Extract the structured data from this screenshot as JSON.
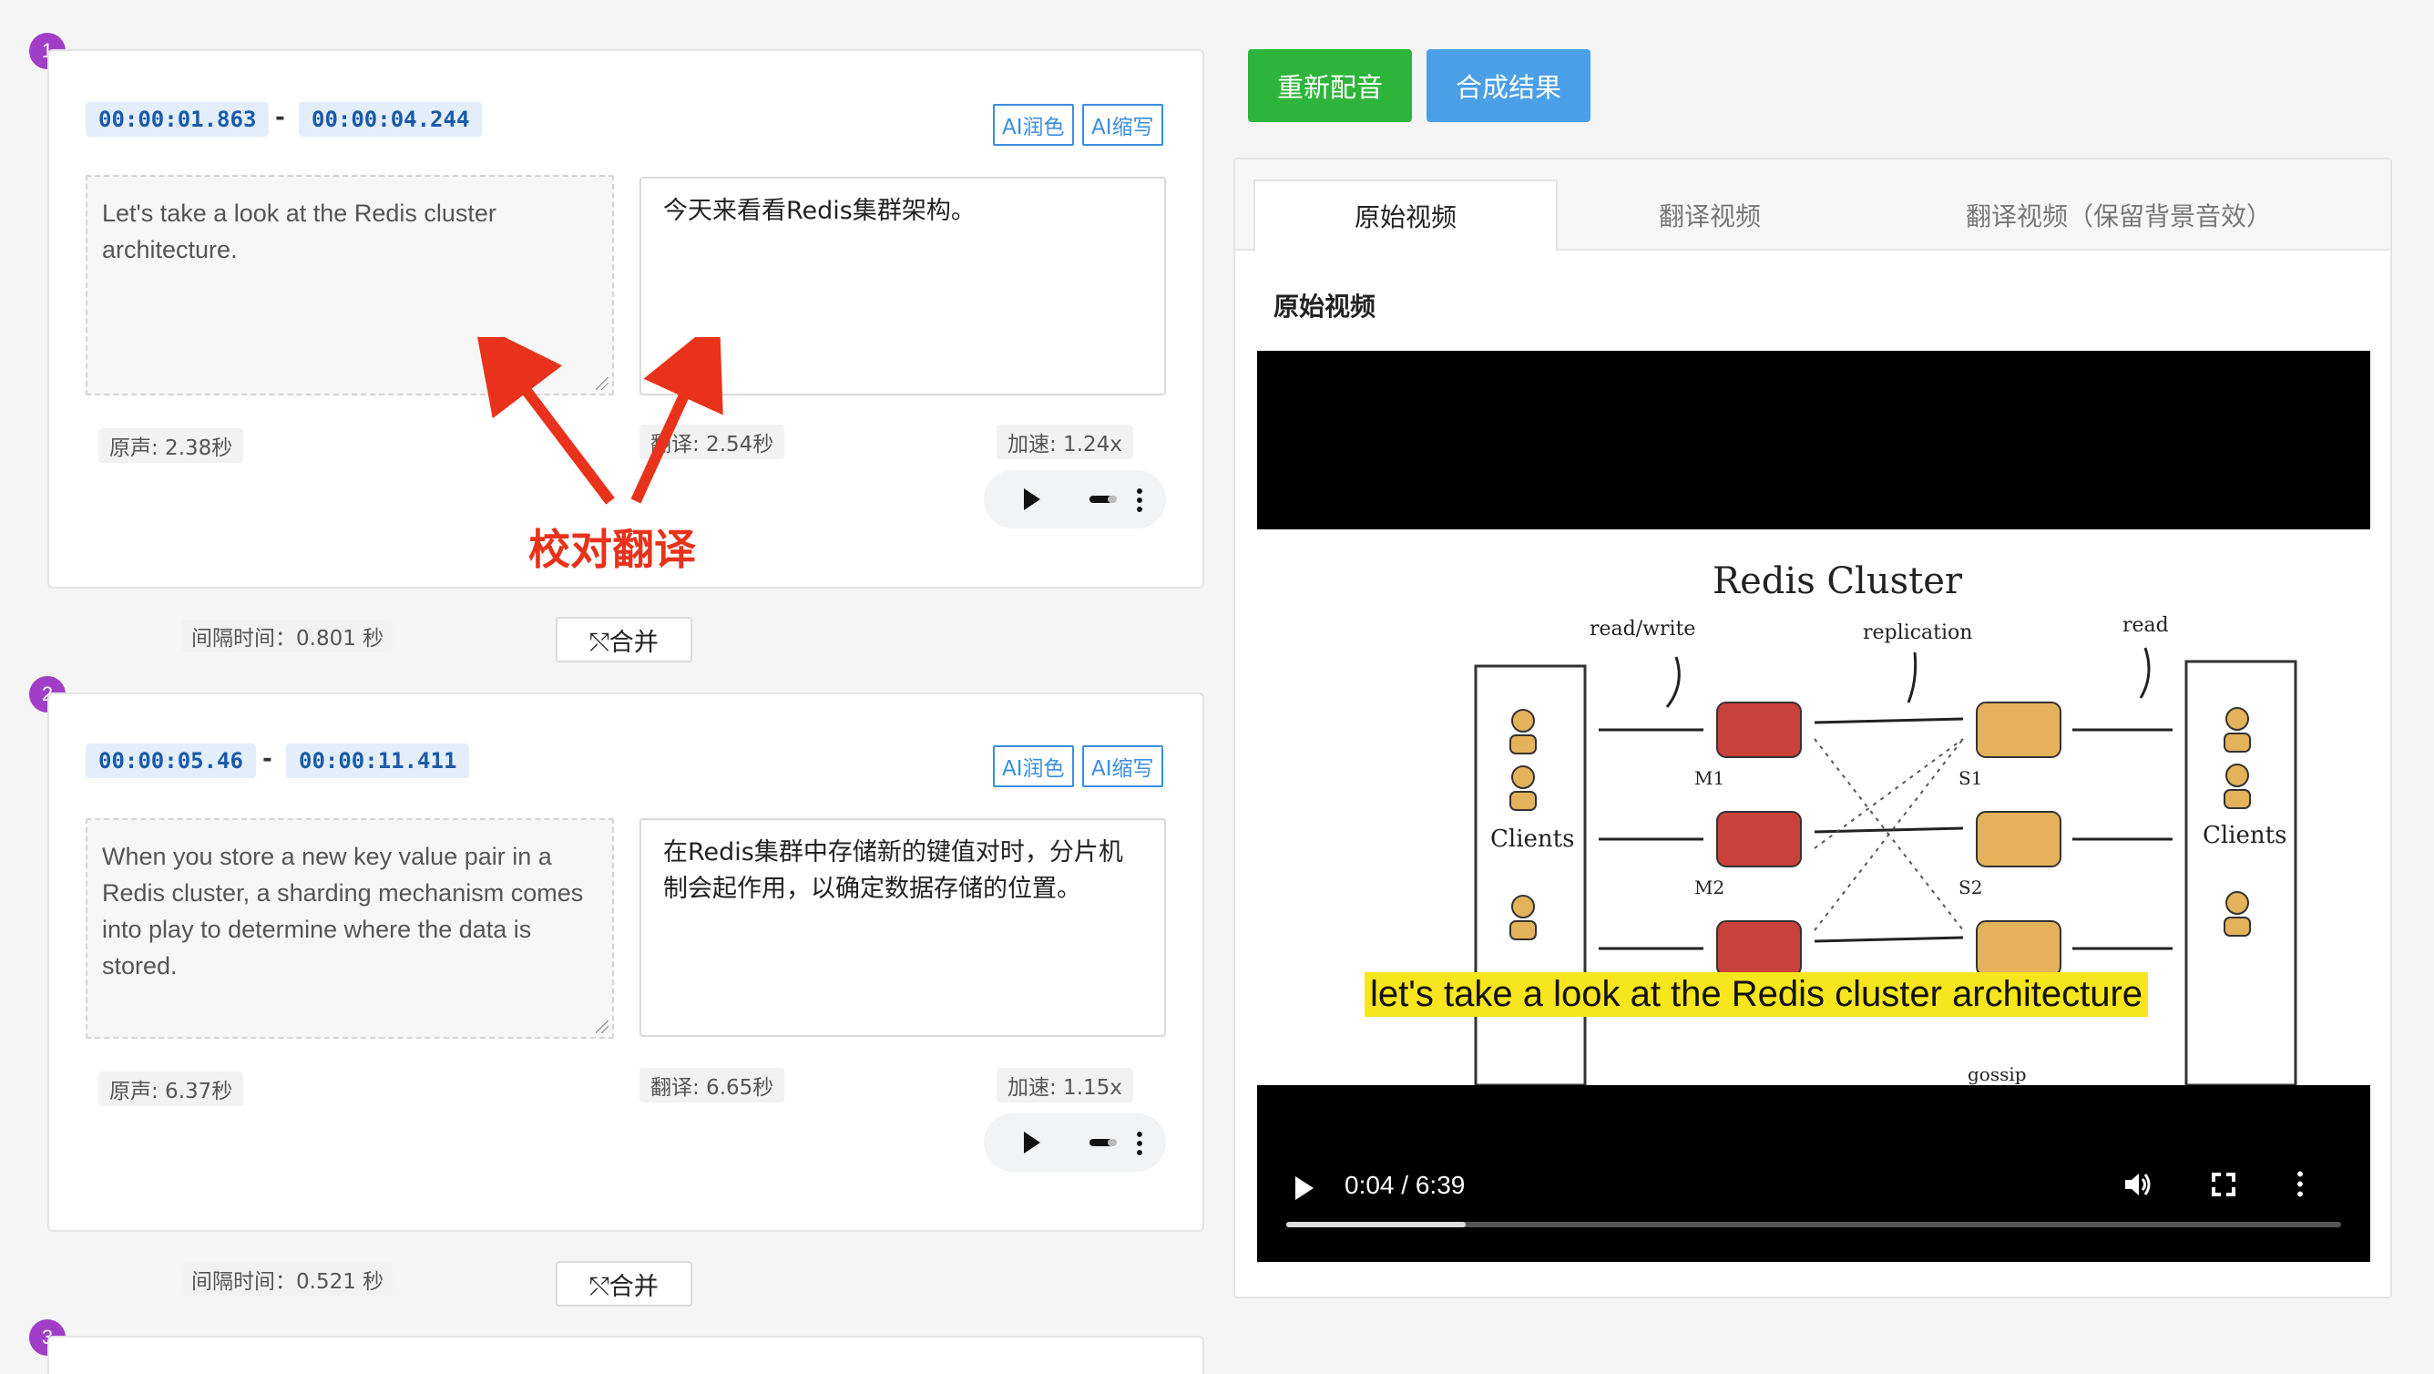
{
  "segments": [
    {
      "number": "1",
      "start": "00:00:01.863",
      "end": "00:00:04.244",
      "dash": "-",
      "polish_label": "AI润色",
      "shorten_label": "AI缩写",
      "source_text": "Let's take a look at the Redis cluster architecture.",
      "translation": "今天来看看Redis集群架构。",
      "orig_duration": "原声: 2.38秒",
      "trans_duration": "翻译: 2.54秒",
      "speed": "加速: 1.24x"
    },
    {
      "number": "2",
      "start": "00:00:05.46",
      "end": "00:00:11.411",
      "dash": "-",
      "polish_label": "AI润色",
      "shorten_label": "AI缩写",
      "source_text": "When you store a new key value pair in a Redis cluster, a sharding mechanism comes into play to determine where the data is stored.",
      "translation": "在Redis集群中存储新的键值对时，分片机制会起作用，以确定数据存储的位置。",
      "orig_duration": "原声: 6.37秒",
      "trans_duration": "翻译: 6.65秒",
      "speed": "加速: 1.15x"
    },
    {
      "number": "3"
    }
  ],
  "gaps": [
    {
      "text": "间隔时间：0.801 秒",
      "merge_label": "⤲合并"
    },
    {
      "text": "间隔时间：0.521 秒",
      "merge_label": "⤲合并"
    }
  ],
  "annotation": {
    "text": "校对翻译",
    "color": "#e8321c"
  },
  "actions": {
    "redub_label": "重新配音",
    "compose_label": "合成结果"
  },
  "tabs": [
    {
      "label": "原始视频",
      "active": true
    },
    {
      "label": "翻译视频",
      "active": false
    },
    {
      "label": "翻译视频（保留背景音效）",
      "active": false
    }
  ],
  "panel_heading": "原始视频",
  "video": {
    "diagram": {
      "title": "Redis Cluster",
      "labels": [
        "read/write",
        "replication",
        "read",
        "Clients",
        "Clients",
        "M1",
        "M2",
        "S1",
        "S2",
        "gossip"
      ]
    },
    "subtitle": "let's take a look at the Redis cluster architecture",
    "current_time": "0:04",
    "separator": "/",
    "duration": "6:39",
    "progress_fraction": 0.17
  },
  "colors": {
    "accent_green": "#2db53b",
    "accent_blue": "#4a9fe6",
    "segment_badge": "#a13ec8",
    "subtitle_bg": "#f7e51d"
  },
  "icons": [
    "play-icon",
    "volume-icon",
    "fullscreen-icon",
    "more-vertical-icon",
    "merge-icon",
    "resize-grip-icon"
  ]
}
